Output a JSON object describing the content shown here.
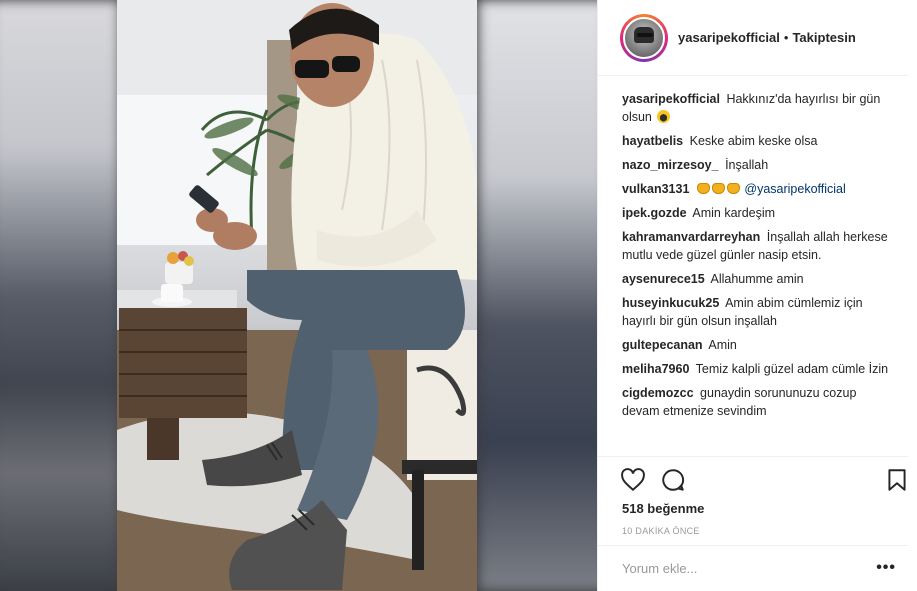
{
  "post": {
    "username": "yasaripekofficial",
    "separator": "•",
    "follow_status": "Takiptesin",
    "avatar_icon": "profile-avatar-icon",
    "likes": "518 beğenme",
    "time": "10 DAKİKA ÖNCE",
    "comment_placeholder": "Yorum ekle...",
    "more_label": "•••"
  },
  "comments": [
    {
      "user": "yasaripekofficial",
      "text": "Hakkınız'da hayırlısı bir gün olsun"
    },
    {
      "user": "hayatbelis",
      "text": "Keske abim keske olsa"
    },
    {
      "user": "nazo_mirzesoy_",
      "text": "İnşallah"
    },
    {
      "user": "vulkan3131",
      "text": "",
      "mention": "@yasaripekofficial"
    },
    {
      "user": "ipek.gozde",
      "text": "Amin kardeşim"
    },
    {
      "user": "kahramanvardarreyhan",
      "text": "İnşallah allah herkese mutlu vede güzel günler nasip etsin."
    },
    {
      "user": "aysenurece15",
      "text": "Allahumme amin"
    },
    {
      "user": "huseyinkucuk25",
      "text": "Amin abim cümlemiz için hayırlı bir gün olsun inşallah"
    },
    {
      "user": "gultepecanan",
      "text": "Amin"
    },
    {
      "user": "meliha7960",
      "text": "Temiz kalpli güzel adam cümle İzin"
    },
    {
      "user": "cigdemozcc",
      "text": "gunaydin sorununuzu cozup devam etmenize sevindim"
    }
  ],
  "icons": {
    "like": "heart-icon",
    "comment": "comment-bubble-icon",
    "save": "bookmark-icon"
  },
  "colors": {
    "mention": "#003569",
    "muted": "#999999",
    "border": "#efefef"
  }
}
